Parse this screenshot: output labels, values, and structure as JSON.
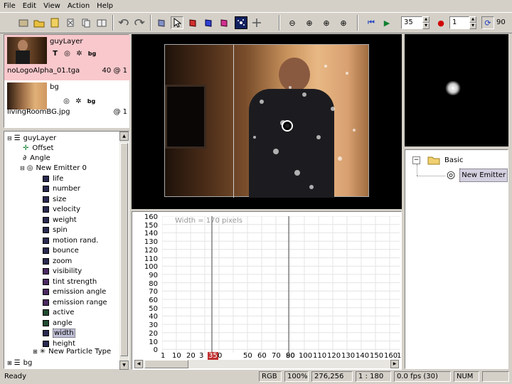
{
  "menu": [
    "File",
    "Edit",
    "View",
    "Action",
    "Help"
  ],
  "toolbar": {
    "frame_value": "35",
    "step_value": "1",
    "loop_value": "90"
  },
  "layers": [
    {
      "name": "guyLayer",
      "file": "noLogoAlpha_01.tga",
      "frame": "40 @ 1",
      "icons": [
        "T",
        "◎",
        "✲",
        "bg"
      ],
      "selected": true
    },
    {
      "name": "bg",
      "file": "livingRoomBG.jpg",
      "frame": "@ 1",
      "icons": [
        "◎",
        "✲",
        "bg"
      ],
      "selected": false
    }
  ],
  "tree": {
    "root": "guyLayer",
    "children": [
      "Offset",
      "Angle"
    ],
    "emitter": "New Emitter 0",
    "properties": [
      "life",
      "number",
      "size",
      "velocity",
      "weight",
      "spin",
      "motion rand.",
      "bounce",
      "zoom",
      "visibility",
      "tint strength",
      "emission angle",
      "emission range",
      "active",
      "angle",
      "width",
      "height"
    ],
    "selected_property": "width",
    "particle_type": "New Particle Type",
    "bg": "bg"
  },
  "curve": {
    "readout": "Width = 170 pixels",
    "y_ticks": [
      "160",
      "150",
      "140",
      "130",
      "120",
      "110",
      "100",
      "90",
      "80",
      "70",
      "60",
      "50",
      "40",
      "30",
      "20",
      "10",
      "0"
    ],
    "x_ticks": [
      "1",
      "10",
      "20",
      "3",
      "35",
      "0",
      "50",
      "60",
      "70",
      "80",
      "90",
      "100",
      "110",
      "120",
      "130",
      "140",
      "150",
      "160",
      "1"
    ],
    "current_frame": "35"
  },
  "emitter_tree": {
    "group": "Basic",
    "item": "New Emitter"
  },
  "status": {
    "left": "Ready",
    "mode": "RGB",
    "zoom": "100%",
    "coords": "276,256",
    "ratio": "1 : 180",
    "fps": "0.0 fps (30)",
    "num": "NUM"
  }
}
